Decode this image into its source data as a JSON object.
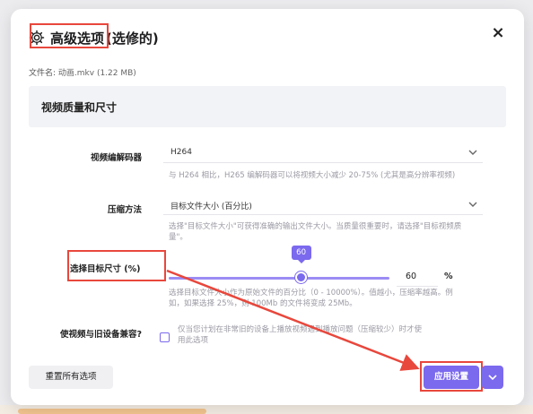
{
  "dialog": {
    "title": "高级选项",
    "title_suffix": "(选修的)",
    "close_symbol": "×",
    "file_label": "文件名:",
    "file_value": "动画.mkv (1.22 MB)",
    "section_title": "视频质量和尺寸"
  },
  "codec": {
    "label": "视频编解码器",
    "value": "H264",
    "help": "与 H264 相比，H265 编解码器可以将视频大小减少 20-75% (尤其是高分辨率视频)"
  },
  "method": {
    "label": "压缩方法",
    "value": "目标文件大小 (百分比)",
    "help_line1": "选择\"目标文件大小\"可获得准确的输出文件大小。当质量很重要时，请选择\"目标视频质",
    "help_line2": "量\"。"
  },
  "target": {
    "label": "选择目标尺寸 (%)",
    "slider_value": 60,
    "slider_max": 100,
    "tooltip": "60",
    "input_value": "60",
    "unit": "%",
    "help_line1": "选择目标文件大小作为原始文件的百分比（0 - 10000%）。值越小，压缩率越高。例",
    "help_line2": "如，如果选择 25%，则 100Mb 的文件将变成 25Mb。"
  },
  "compat": {
    "label": "使视频与旧设备兼容?",
    "help_line1": "仅当您计划在非常旧的设备上播放视频遇到播放问题（压缩较少）时才使",
    "help_line2": "用此选项"
  },
  "footer": {
    "reset_label": "重置所有选项",
    "apply_label": "应用设置"
  },
  "colors": {
    "accent": "#7b69ee",
    "highlight": "#e8473c"
  },
  "icons": {
    "title": "gear-icon",
    "close": "close-icon",
    "select": "chevron-down-icon"
  }
}
